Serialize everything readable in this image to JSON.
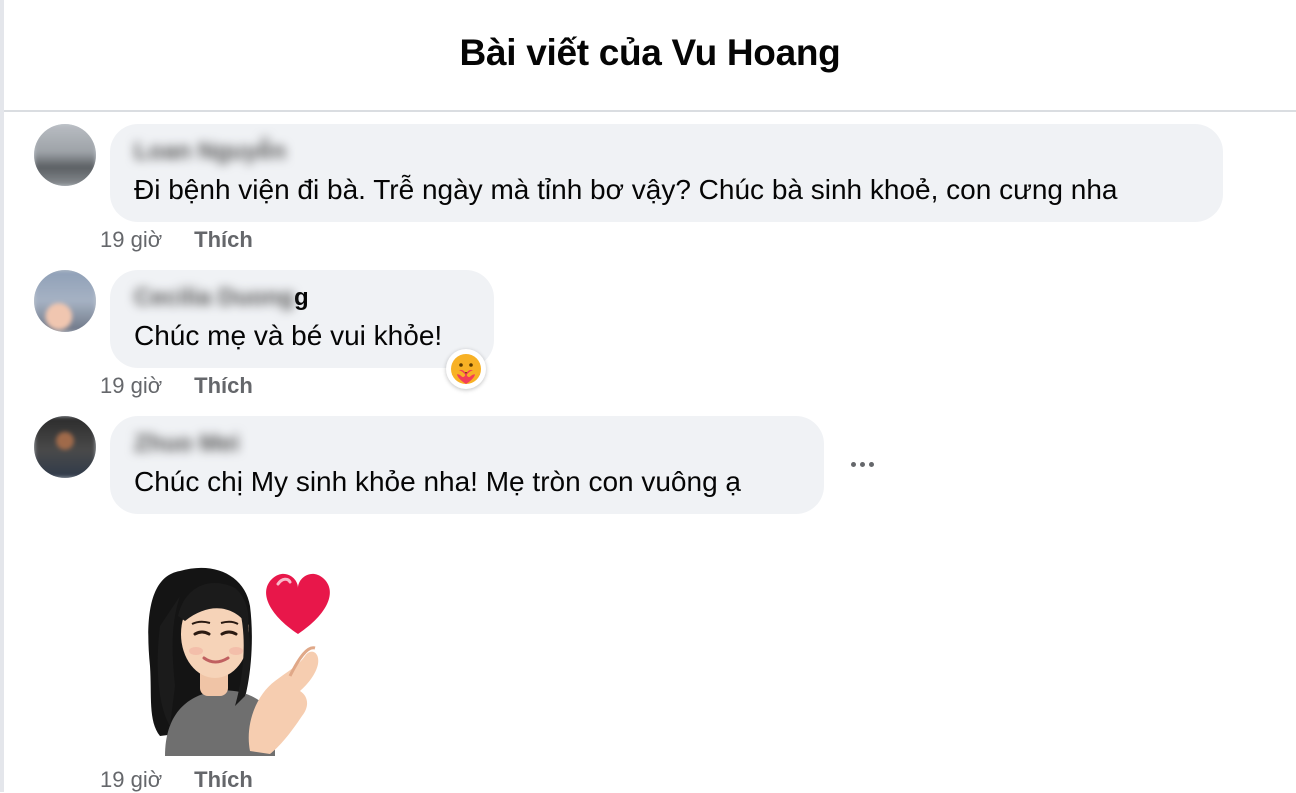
{
  "header": {
    "title": "Bài viết của Vu Hoang"
  },
  "comments": [
    {
      "author": "Loan Nguyễn",
      "text": "Đi bệnh viện đi bà. Trễ ngày mà tỉnh bơ vậy? Chúc bà sinh khoẻ, con cưng nha",
      "time": "19 giờ",
      "like": "Thích"
    },
    {
      "author": "Cecilia Duong",
      "author_tail": "g",
      "text": "Chúc mẹ và bé vui khỏe!",
      "time": "19 giờ",
      "like": "Thích",
      "reaction_icon": "care-reaction-icon"
    },
    {
      "author": "Zhuo Mei",
      "text": "Chúc chị My sinh khỏe nha! Mẹ tròn con vuông ạ",
      "time": "19 giờ",
      "like": "Thích"
    }
  ],
  "sticker_comment": {
    "sticker_icon": "avatar-heart-sticker",
    "time": "19 giờ",
    "like": "Thích"
  },
  "colors": {
    "bubble": "#f0f2f5",
    "meta": "#65676b",
    "heart": "#e8174a"
  }
}
